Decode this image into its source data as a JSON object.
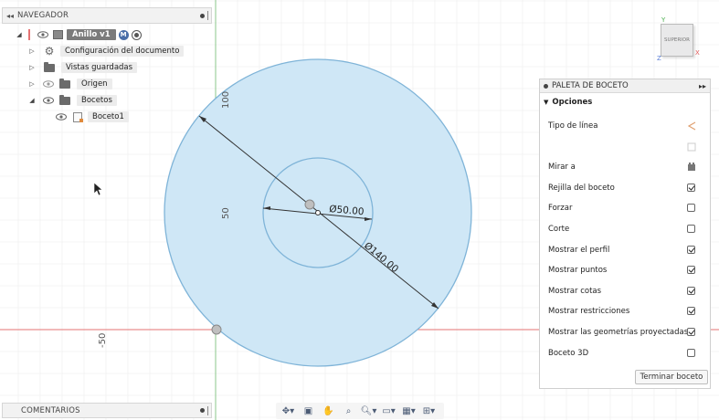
{
  "navigator": {
    "title": "NAVEGADOR",
    "collapse_glyph": "◂◂",
    "items": [
      {
        "label": "Anillo v1",
        "level": 0,
        "badge": "M"
      },
      {
        "label": "Configuración del documento",
        "level": 1
      },
      {
        "label": "Vistas guardadas",
        "level": 1
      },
      {
        "label": "Origen",
        "level": 1
      },
      {
        "label": "Bocetos",
        "level": 1
      },
      {
        "label": "Boceto1",
        "level": 2
      }
    ]
  },
  "comments": {
    "title": "COMENTARIOS"
  },
  "palette": {
    "title": "PALETA DE BOCETO",
    "expand_glyph": "▸▸",
    "section": "Opciones",
    "rows": [
      {
        "label": "Tipo de línea",
        "control": "icon",
        "icon": "linetype-icon"
      },
      {
        "label": "",
        "control": "icon",
        "icon": "construction-icon"
      },
      {
        "label": "Mirar a",
        "control": "icon",
        "icon": "look-at-icon"
      },
      {
        "label": "Rejilla del boceto",
        "control": "checkbox",
        "checked": true
      },
      {
        "label": "Forzar",
        "control": "checkbox",
        "checked": false
      },
      {
        "label": "Corte",
        "control": "checkbox",
        "checked": false
      },
      {
        "label": "Mostrar el perfil",
        "control": "checkbox",
        "checked": true
      },
      {
        "label": "Mostrar puntos",
        "control": "checkbox",
        "checked": true
      },
      {
        "label": "Mostrar cotas",
        "control": "checkbox",
        "checked": true
      },
      {
        "label": "Mostrar restricciones",
        "control": "checkbox",
        "checked": true
      },
      {
        "label": "Mostrar las geometrías proyectadas",
        "control": "checkbox",
        "checked": true
      },
      {
        "label": "Boceto 3D",
        "control": "checkbox",
        "checked": false
      }
    ],
    "finish_label": "Terminar boceto"
  },
  "viewcube": {
    "face": "SUPERIOR",
    "axis_z": "Z",
    "axis_x": "X",
    "axis_y": "Y"
  },
  "dimensions": {
    "inner_diameter": "Ø50.00",
    "outer_diameter": "Ø140.00",
    "ruler_top": "100",
    "ruler_mid": "50",
    "ruler_low": "-50"
  },
  "colors": {
    "fill": "#cfe7f6",
    "stroke": "#7fb4d8",
    "axis_red": "#e57373",
    "axis_green": "#8bc78b",
    "grid": "#ececec"
  },
  "toolbar": {
    "icons": [
      "orbit-icon",
      "look-at-icon",
      "pan-icon",
      "zoom-fit-icon",
      "zoom-icon",
      "display-mode-icon",
      "grid-icon",
      "viewports-icon"
    ]
  }
}
